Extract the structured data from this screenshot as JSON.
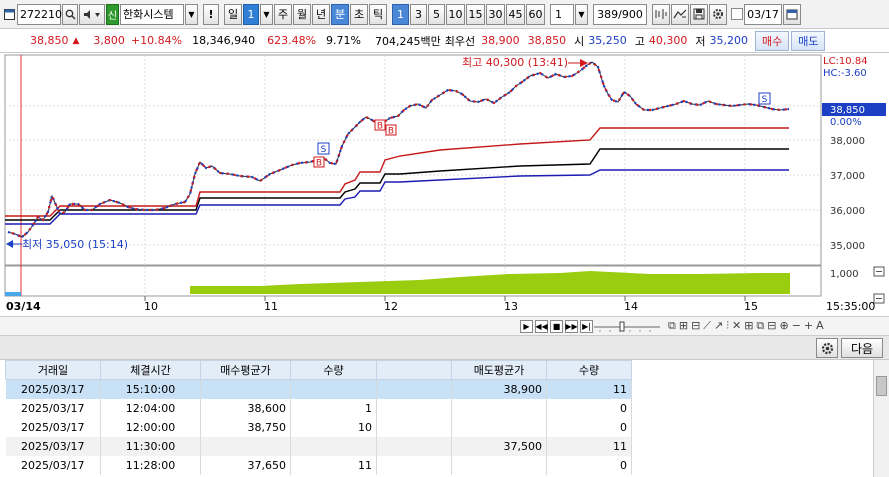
{
  "toolbar": {
    "code": "272210",
    "new_badge": "신",
    "stock_name": "한화시스템",
    "alert": "!",
    "period_day": "일",
    "period_num": "1",
    "period_week": "주",
    "period_month": "월",
    "period_year": "년",
    "period_min": "분",
    "period_sec": "초",
    "period_tick": "틱",
    "tick_options": [
      "1",
      "3",
      "5",
      "10",
      "15",
      "30",
      "45",
      "60"
    ],
    "multiplier": "1",
    "count": "389",
    "count_total": "/900",
    "date": "03/17"
  },
  "quote": {
    "price": "38,850",
    "change": "3,800",
    "rate": "+10.84%",
    "volume": "18,346,940",
    "vol_ratio": "623.48%",
    "turnover": "9.71%",
    "amount": "704,245백만",
    "best_label": "최우선",
    "best_ask": "38,900",
    "best_bid": "38,850",
    "open_label": "시",
    "open": "35,250",
    "high_label": "고",
    "high": "40,300",
    "low_label": "저",
    "low": "35,200",
    "buy": "매수",
    "sell": "매도"
  },
  "chart": {
    "high_annot": "최고 40,300 (13:41)",
    "low_annot": "최저 35,050 (15:14)",
    "lc": "LC:10.84",
    "hc": "HC:-3.60",
    "current": "38,850",
    "current_pct": "0.00%",
    "y_ticks": [
      "38,000",
      "37,000",
      "36,000",
      "35,000"
    ],
    "vol_tick": "1,000",
    "x_labels": [
      "03/14",
      "10",
      "11",
      "12",
      "13",
      "14",
      "15"
    ],
    "end_time": "15:35:00",
    "signal_s": "S",
    "signal_b": "B"
  },
  "lower": {
    "next": "다음"
  },
  "table": {
    "headers": [
      "거래일",
      "체결시간",
      "매수평균가",
      "수량",
      "",
      "매도평균가",
      "수량"
    ],
    "rows": [
      [
        "2025/03/17",
        "15:10:00",
        "",
        "",
        "",
        "38,900",
        "11"
      ],
      [
        "2025/03/17",
        "12:04:00",
        "38,600",
        "1",
        "",
        "",
        "0"
      ],
      [
        "2025/03/17",
        "12:00:00",
        "38,750",
        "10",
        "",
        "",
        "0"
      ],
      [
        "2025/03/17",
        "11:30:00",
        "",
        "",
        "",
        "37,500",
        "11"
      ],
      [
        "2025/03/17",
        "11:28:00",
        "37,650",
        "11",
        "",
        "",
        "0"
      ]
    ]
  },
  "colors": {
    "up": "#d2191e",
    "down": "#1c3fc4",
    "volume": "#9acd10",
    "highlight": "#c9e1f6"
  }
}
